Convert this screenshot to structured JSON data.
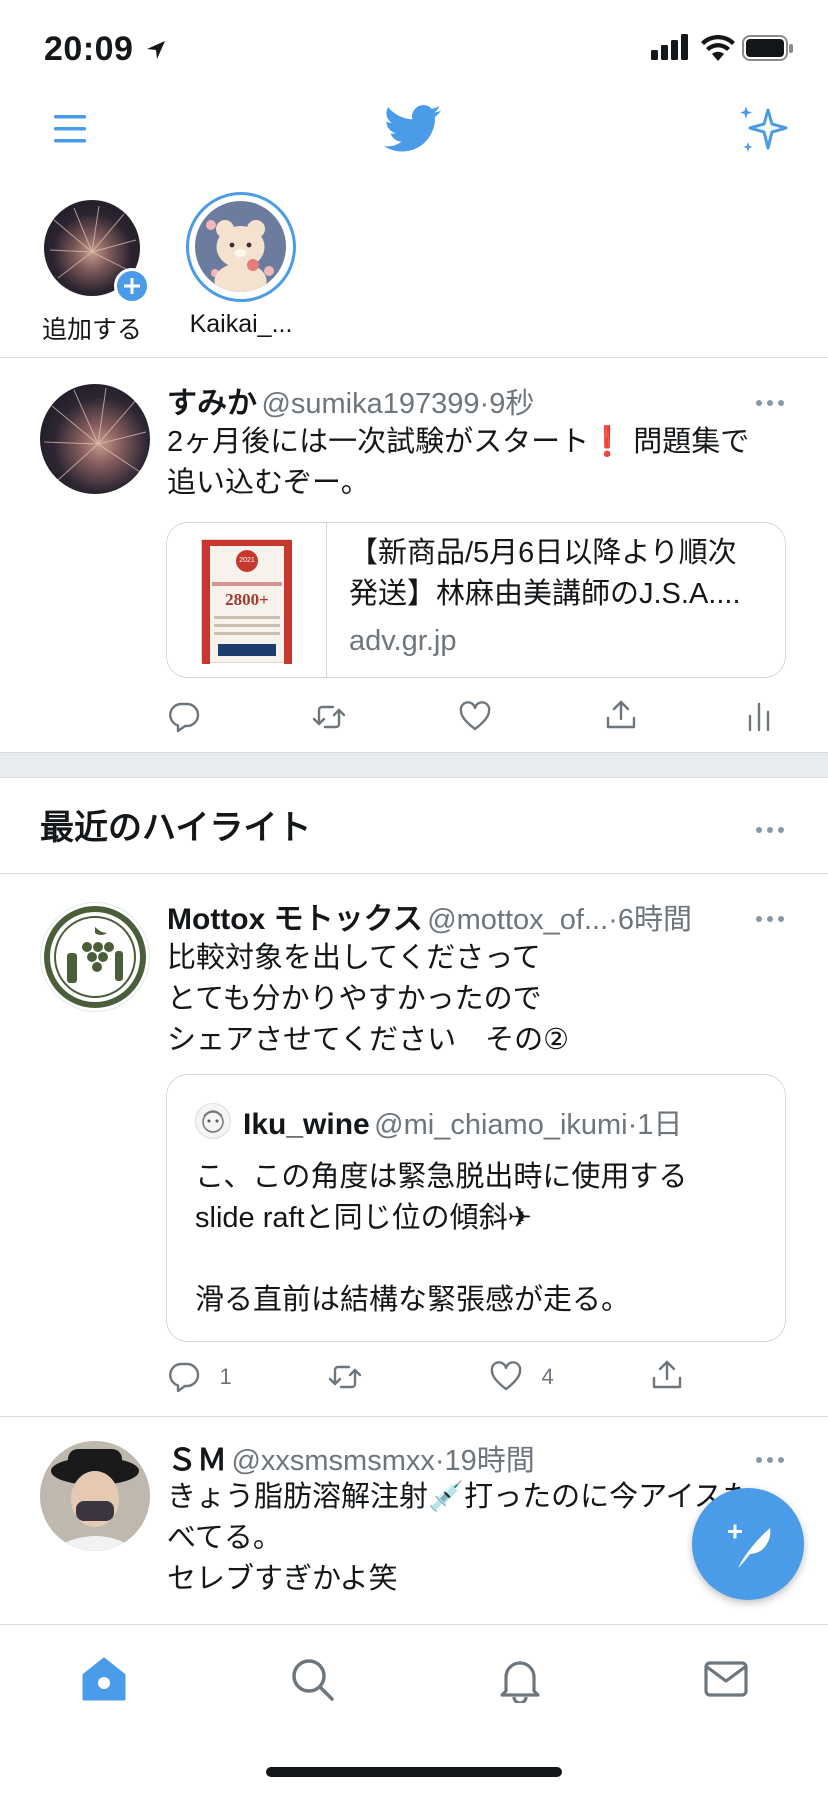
{
  "status_bar": {
    "time": "20:09"
  },
  "fleets": [
    {
      "label": "追加する"
    },
    {
      "label": "Kaikai_..."
    }
  ],
  "tweet1": {
    "name": "すみか",
    "handle": "@sumika197399",
    "time": "·9秒",
    "text_line1": "2ヶ月後には一次試験がスタート❗ 問題集で",
    "text_line2": "追い込むぞー。",
    "card": {
      "title_line1": "【新商品/5月6日以降より順次",
      "title_line2": "発送】林麻由美講師のJ.S.A....",
      "domain": "adv.gr.jp",
      "book_text": "2800+",
      "book_year": "2021"
    }
  },
  "highlights": {
    "title": "最近のハイライト"
  },
  "tweet2": {
    "name": "Mottox モトックス",
    "handle": "@mottox_of...",
    "time": "·6時間",
    "text_line1": "比較対象を出してくださって",
    "text_line2": "とても分かりやすかったので",
    "text_line3": "シェアさせてください　その②",
    "quote": {
      "name": "Iku_wine",
      "handle": "@mi_chiamo_ikumi",
      "time": "·1日",
      "text_line1": "こ、この角度は緊急脱出時に使用する",
      "text_line2": "slide raftと同じ位の傾斜✈",
      "text_line3": "滑る直前は結構な緊張感が走る。"
    },
    "reply_count": "1",
    "like_count": "4"
  },
  "tweet3": {
    "name": "ＳＭ",
    "handle": "@xxsmsmsmxx",
    "time": "·19時間",
    "text_line1": "きょう脂肪溶解注射💉打ったのに今アイスた",
    "text_line2": "べてる。",
    "text_line3": "セレブすぎかよ笑"
  },
  "colors": {
    "accent": "#4a9be8",
    "text": "#14171a",
    "secondary": "#6e767d",
    "divider": "#d6dbdf"
  }
}
